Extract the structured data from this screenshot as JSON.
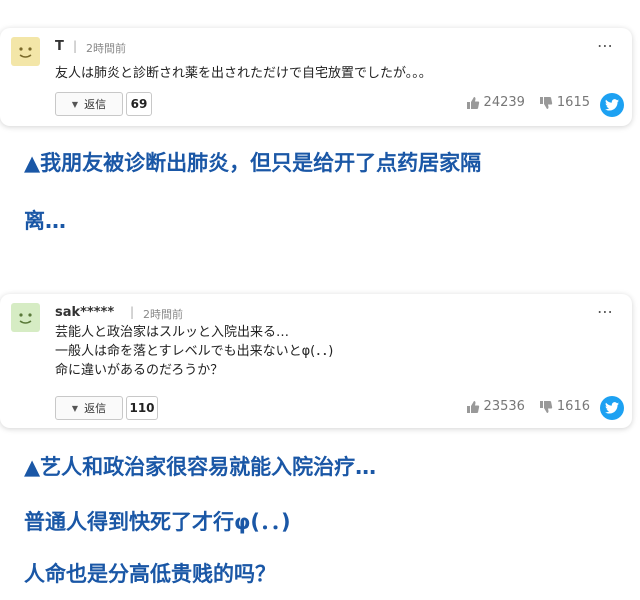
{
  "comments": [
    {
      "username": "T",
      "separator": "|",
      "time": "2時間前",
      "body": "友人は肺炎と診断され薬を出されただけで自宅放置でしたが。。。",
      "reply_label": "返信",
      "reply_count": "69",
      "likes": "24239",
      "dislikes": "1615",
      "avatar_color": "#f3e6a8"
    },
    {
      "username": "sak*****",
      "separator": "|",
      "time": "2時間前",
      "body_lines": [
        "芸能人と政治家はスルッと入院出来る…",
        "一般人は命を落とすレベルでも出来ないとφ(．．)",
        "命に違いがあるのだろうか？"
      ],
      "reply_label": "返信",
      "reply_count": "110",
      "likes": "23536",
      "dislikes": "1616",
      "avatar_color": "#d6ecc4"
    }
  ],
  "captions": {
    "first": [
      "▲我朋友被诊断出肺炎，但只是给开了点药居家隔",
      "离…"
    ],
    "second": [
      "▲艺人和政治家很容易就能入院治疗…",
      "普通人得到快死了才行φ(．．)",
      "人命也是分高低贵贱的吗？"
    ]
  },
  "colors": {
    "caption": "#1a57a6",
    "twitter": "#1da1f2"
  },
  "icons": {
    "more": "⋯",
    "like": "thumbs-up-icon",
    "dislike": "thumbs-down-icon",
    "share": "twitter-icon",
    "reply_arrow": "▼"
  }
}
